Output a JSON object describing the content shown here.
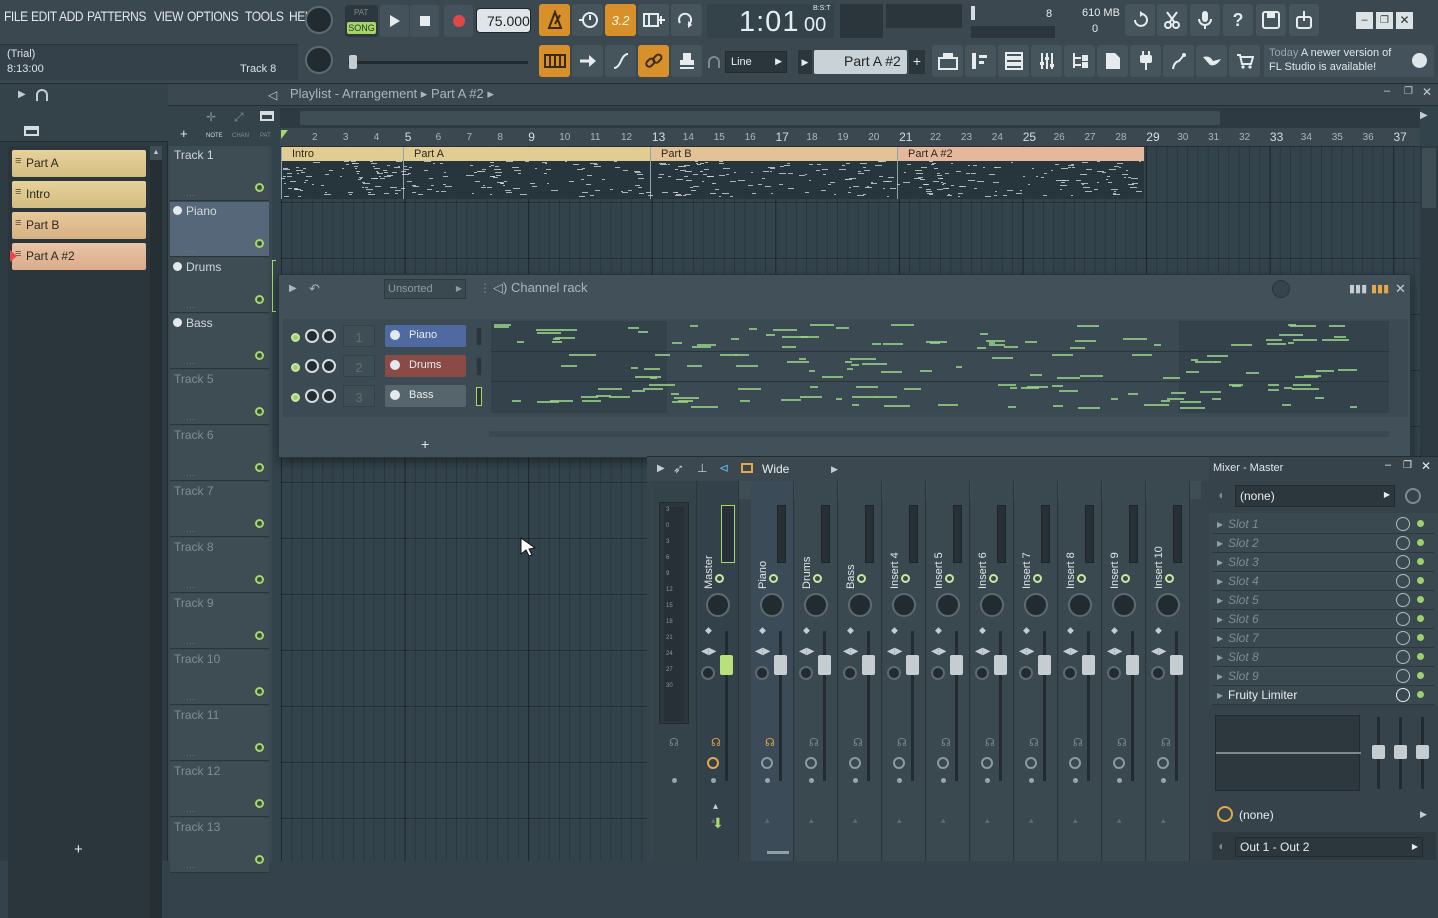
{
  "menu": [
    "FILE",
    "EDIT",
    "ADD",
    "PATTERNS",
    "VIEW",
    "OPTIONS",
    "TOOLS",
    "HELP"
  ],
  "transport": {
    "pat_label": "PAT",
    "song_label": "SONG",
    "tempo": "75.000",
    "time": "1:01",
    "time_small": "00",
    "bst": "B:S:T",
    "cpu_value": "8",
    "memory": "610 MB",
    "voices": "0",
    "snap": "Line",
    "pattern": "Part A #2",
    "counter_display": "3.2"
  },
  "hint": {
    "line1": "(Trial)",
    "line2": "8:13:00",
    "track": "Track 8"
  },
  "news": {
    "label": "Today",
    "text1": "A newer version of",
    "text2": "FL Studio is available!"
  },
  "browser": {
    "patterns": [
      "Part A",
      "Intro",
      "Part B",
      "Part A #2"
    ],
    "add": "+"
  },
  "playlist": {
    "breadcrumb": [
      "Playlist - Arrangement",
      "Part A #2"
    ],
    "ruler": [
      "2",
      "3",
      "4",
      "5",
      "6",
      "7",
      "8",
      "9",
      "10",
      "11",
      "12",
      "13",
      "14",
      "15",
      "16",
      "17",
      "18",
      "19",
      "20",
      "21",
      "22",
      "23",
      "24",
      "25",
      "26",
      "27",
      "28",
      "29",
      "30",
      "31",
      "32",
      "33",
      "34",
      "35",
      "36",
      "37"
    ],
    "ruler_big": [
      "5",
      "9",
      "13",
      "17",
      "21",
      "25",
      "29",
      "33",
      "37"
    ],
    "tracks": [
      "Track 1",
      "Piano",
      "Drums",
      "Bass",
      "Track 5",
      "Track 6",
      "Track 7",
      "Track 8",
      "Track 9",
      "Track 10",
      "Track 11",
      "Track 12",
      "Track 13"
    ],
    "clips": [
      "Intro",
      "Part A",
      "Part B",
      "Part A #2"
    ],
    "add": "+",
    "header_labels": [
      "NOTE",
      "CHAN",
      "PAT"
    ]
  },
  "rack": {
    "filter": "Unsorted",
    "title": "Channel rack",
    "channels": [
      {
        "num": "1",
        "name": "Piano"
      },
      {
        "num": "2",
        "name": "Drums"
      },
      {
        "num": "3",
        "name": "Bass"
      }
    ],
    "add": "+"
  },
  "mixer": {
    "view": "Wide",
    "title": "Mixer - Master",
    "header": [
      "C",
      "M",
      "1",
      "2",
      "3",
      "4",
      "5",
      "6",
      "7",
      "8",
      "9",
      "10"
    ],
    "strips": [
      "Master",
      "Piano",
      "Drums",
      "Bass",
      "Insert 4",
      "Insert 5",
      "Insert 6",
      "Insert 7",
      "Insert 8",
      "Insert 9",
      "Insert 10"
    ],
    "meter_ticks": [
      "3",
      "0",
      "3",
      "6",
      "9",
      "12",
      "15",
      "18",
      "21",
      "24",
      "27",
      "30"
    ],
    "input": "(none)",
    "slots": [
      "Slot 1",
      "Slot 2",
      "Slot 3",
      "Slot 4",
      "Slot 5",
      "Slot 6",
      "Slot 7",
      "Slot 8",
      "Slot 9"
    ],
    "effect": "Fruity Limiter",
    "send": "(none)",
    "output": "Out 1 - Out 2"
  }
}
